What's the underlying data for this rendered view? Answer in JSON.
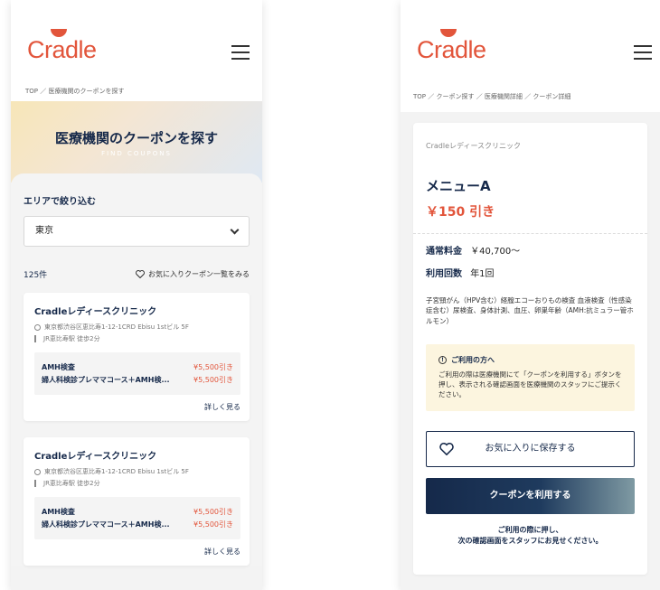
{
  "left": {
    "logo": "Cradle",
    "breadcrumb": "TOP ／ 医療機関のクーポンを探す",
    "hero": {
      "title": "医療機関のクーポンを探す",
      "subtitle": "FIND COUPONS"
    },
    "filter": {
      "label": "エリアで絞り込む",
      "selected": "東京"
    },
    "count": "125件",
    "fav_link": "お気に入りクーポン一覧をみる",
    "cards": [
      {
        "clinic": "Cradleレディースクリニック",
        "address": "東京都渋谷区恵比寿1-12-1CRD Ebisu 1stビル 5F",
        "access": "JR恵比寿駅 徒歩2分",
        "coupons": [
          {
            "name": "AMH検査",
            "price": "¥5,500引き"
          },
          {
            "name": "婦人科検診プレママコース＋AMH検...",
            "price": "¥5,500引き"
          }
        ],
        "detail_link": "詳しく見る"
      },
      {
        "clinic": "Cradleレディースクリニック",
        "address": "東京都渋谷区恵比寿1-12-1CRD Ebisu 1stビル 5F",
        "access": "JR恵比寿駅 徒歩2分",
        "coupons": [
          {
            "name": "AMH検査",
            "price": "¥5,500引き"
          },
          {
            "name": "婦人科検診プレママコース＋AMH検...",
            "price": "¥5,500引き"
          }
        ],
        "detail_link": "詳しく見る"
      }
    ]
  },
  "right": {
    "logo": "Cradle",
    "breadcrumb": "TOP ／ クーポン探す ／ 医療機関詳細 ／ クーポン詳細",
    "clinic": "Cradleレディースクリニック",
    "menu": "メニューA",
    "discount": "￥150 引き",
    "regular_label": "通常料金",
    "regular_value": "￥40,700〜",
    "usage_label": "利用回数",
    "usage_value": "年1回",
    "description": "子宮頸がん（HPV含む）経膣エコーおりもの検査 血液検査（性感染症含む）尿検査、身体計測、血圧、卵巣年齢（AMH:抗ミュラー管ホルモン）",
    "notice": {
      "title": "ご利用の方へ",
      "text": "ご利用の際は医療機関にて「クーポンを利用する」ボタンを押し、表示される確認画面を医療機関のスタッフにご提示ください。"
    },
    "save_button": "お気に入りに保存する",
    "use_button": "クーポンを利用する",
    "use_note_1": "ご利用の際に押し、",
    "use_note_2": "次の確認画面をスタッフにお見せください。"
  },
  "colors": {
    "brand": "#e2553b",
    "navy": "#16294a",
    "notice_bg": "#fcf5df"
  }
}
